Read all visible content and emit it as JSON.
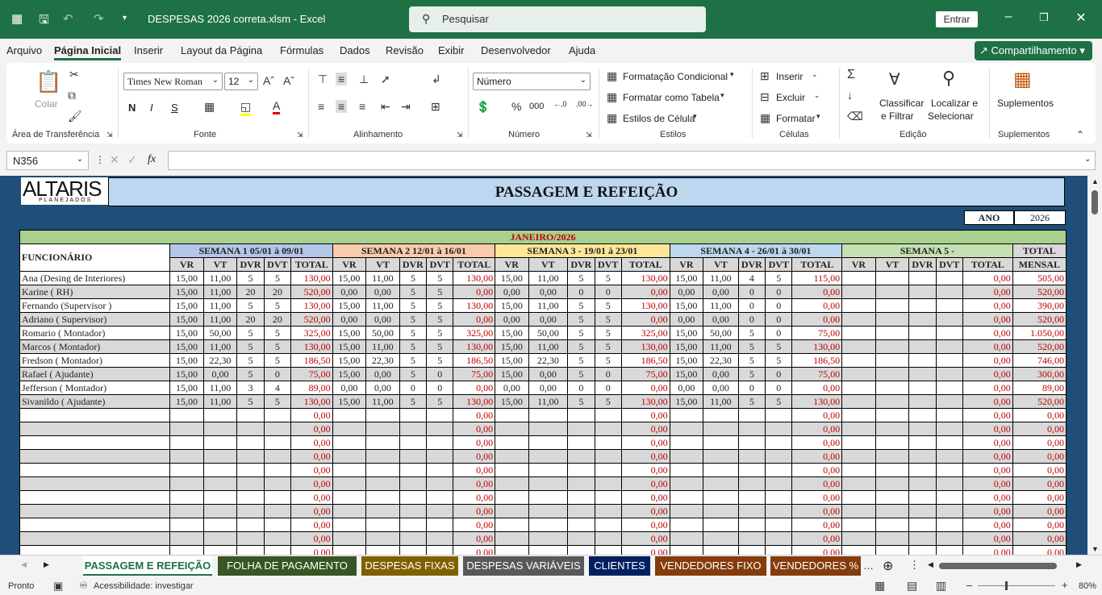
{
  "window": {
    "title": "DESPESAS 2026 correta.xlsm  -  Excel",
    "search_placeholder": "Pesquisar",
    "signin": "Entrar"
  },
  "menu": [
    "Arquivo",
    "Página Inicial",
    "Inserir",
    "Layout da Página",
    "Fórmulas",
    "Dados",
    "Revisão",
    "Exibir",
    "Desenvolvedor",
    "Ajuda"
  ],
  "share_label": "Compartilhamento",
  "ribbon": {
    "paste_label": "Colar",
    "clipboard_group": "Área de Transferência",
    "font_name": "Times New Roman",
    "font_size": "12",
    "bold": "N",
    "italic": "I",
    "underline": "S",
    "font_group": "Fonte",
    "align_group": "Alinhamento",
    "number_format": "Número",
    "number_group": "Número",
    "cond_format": "Formatação Condicional",
    "format_table": "Formatar como Tabela",
    "cell_styles": "Estilos de Célula",
    "styles_group": "Estilos",
    "insert": "Inserir",
    "delete": "Excluir",
    "format": "Formatar",
    "cells_group": "Células",
    "sort_filter_1": "Classificar",
    "sort_filter_2": "e Filtrar",
    "find_select_1": "Localizar e",
    "find_select_2": "Selecionar",
    "editing_group": "Edição",
    "addins": "Suplementos",
    "addins_group": "Suplementos"
  },
  "namebox": "N356",
  "fx": "fx",
  "sheet": {
    "logo_main": "ALTARIS",
    "logo_sub": "PLANEJADOS",
    "title": "PASSAGEM E REFEIÇÃO",
    "ano_label": "ANO",
    "ano_value": "2026",
    "month": "JANEIRO/2026",
    "employee_header": "FUNCIONÁRIO",
    "weeks": [
      "SEMANA 1 05/01 à 09/01",
      "SEMANA 2 12/01 à 16/01",
      "SEMANA 3 - 19/01 à 23/01",
      "SEMANA 4 - 26/01 à 30/01",
      "SEMANA 5 -"
    ],
    "week_colors": [
      "#b4c6e7",
      "#f8cbad",
      "#ffe699",
      "#bdd7ee",
      "#c6e0b4"
    ],
    "subheaders": [
      "VR",
      "VT",
      "DVR",
      "DVT",
      "TOTAL"
    ],
    "total_header_1": "TOTAL",
    "total_header_2": "MENSAL",
    "rows": [
      {
        "name": "Ana (Desing de Interiores)",
        "w": [
          [
            "15,00",
            "11,00",
            "5",
            "5",
            "130,00"
          ],
          [
            "15,00",
            "11,00",
            "5",
            "5",
            "130,00"
          ],
          [
            "15,00",
            "11,00",
            "5",
            "5",
            "130,00"
          ],
          [
            "15,00",
            "11,00",
            "4",
            "5",
            "115,00"
          ],
          [
            "",
            "",
            "",
            "",
            "0,00"
          ]
        ],
        "total": "505,00"
      },
      {
        "name": "Karine ( RH)",
        "w": [
          [
            "15,00",
            "11,00",
            "20",
            "20",
            "520,00"
          ],
          [
            "0,00",
            "0,00",
            "5",
            "5",
            "0,00"
          ],
          [
            "0,00",
            "0,00",
            "0",
            "0",
            "0,00"
          ],
          [
            "0,00",
            "0,00",
            "0",
            "0",
            "0,00"
          ],
          [
            "",
            "",
            "",
            "",
            "0,00"
          ]
        ],
        "total": "520,00"
      },
      {
        "name": "Fernando (Supervisor )",
        "w": [
          [
            "15,00",
            "11,00",
            "5",
            "5",
            "130,00"
          ],
          [
            "15,00",
            "11,00",
            "5",
            "5",
            "130,00"
          ],
          [
            "15,00",
            "11,00",
            "5",
            "5",
            "130,00"
          ],
          [
            "15,00",
            "11,00",
            "0",
            "0",
            "0,00"
          ],
          [
            "",
            "",
            "",
            "",
            "0,00"
          ]
        ],
        "total": "390,00"
      },
      {
        "name": "Adriano ( Supervisor)",
        "w": [
          [
            "15,00",
            "11,00",
            "20",
            "20",
            "520,00"
          ],
          [
            "0,00",
            "0,00",
            "5",
            "5",
            "0,00"
          ],
          [
            "0,00",
            "0,00",
            "5",
            "5",
            "0,00"
          ],
          [
            "0,00",
            "0,00",
            "0",
            "0",
            "0,00"
          ],
          [
            "",
            "",
            "",
            "",
            "0,00"
          ]
        ],
        "total": "520,00"
      },
      {
        "name": "Romario ( Montador)",
        "w": [
          [
            "15,00",
            "50,00",
            "5",
            "5",
            "325,00"
          ],
          [
            "15,00",
            "50,00",
            "5",
            "5",
            "325,00"
          ],
          [
            "15,00",
            "50,00",
            "5",
            "5",
            "325,00"
          ],
          [
            "15,00",
            "50,00",
            "5",
            "0",
            "75,00"
          ],
          [
            "",
            "",
            "",
            "",
            "0,00"
          ]
        ],
        "total": "1.050,00"
      },
      {
        "name": "Marcos ( Montador)",
        "w": [
          [
            "15,00",
            "11,00",
            "5",
            "5",
            "130,00"
          ],
          [
            "15,00",
            "11,00",
            "5",
            "5",
            "130,00"
          ],
          [
            "15,00",
            "11,00",
            "5",
            "5",
            "130,00"
          ],
          [
            "15,00",
            "11,00",
            "5",
            "5",
            "130,00"
          ],
          [
            "",
            "",
            "",
            "",
            "0,00"
          ]
        ],
        "total": "520,00"
      },
      {
        "name": "Fredson ( Montador)",
        "w": [
          [
            "15,00",
            "22,30",
            "5",
            "5",
            "186,50"
          ],
          [
            "15,00",
            "22,30",
            "5",
            "5",
            "186,50"
          ],
          [
            "15,00",
            "22,30",
            "5",
            "5",
            "186,50"
          ],
          [
            "15,00",
            "22,30",
            "5",
            "5",
            "186,50"
          ],
          [
            "",
            "",
            "",
            "",
            "0,00"
          ]
        ],
        "total": "746,00"
      },
      {
        "name": "Rafael ( Ajudante)",
        "w": [
          [
            "15,00",
            "0,00",
            "5",
            "0",
            "75,00"
          ],
          [
            "15,00",
            "0,00",
            "5",
            "0",
            "75,00"
          ],
          [
            "15,00",
            "0,00",
            "5",
            "0",
            "75,00"
          ],
          [
            "15,00",
            "0,00",
            "5",
            "0",
            "75,00"
          ],
          [
            "",
            "",
            "",
            "",
            "0,00"
          ]
        ],
        "total": "300,00"
      },
      {
        "name": "Jefferson ( Montador)",
        "w": [
          [
            "15,00",
            "11,00",
            "3",
            "4",
            "89,00"
          ],
          [
            "0,00",
            "0,00",
            "0",
            "0",
            "0,00"
          ],
          [
            "0,00",
            "0,00",
            "0",
            "0",
            "0,00"
          ],
          [
            "0,00",
            "0,00",
            "0",
            "0",
            "0,00"
          ],
          [
            "",
            "",
            "",
            "",
            "0,00"
          ]
        ],
        "total": "89,00"
      },
      {
        "name": "Sivanildo ( Ajudante)",
        "w": [
          [
            "15,00",
            "11,00",
            "5",
            "5",
            "130,00"
          ],
          [
            "15,00",
            "11,00",
            "5",
            "5",
            "130,00"
          ],
          [
            "15,00",
            "11,00",
            "5",
            "5",
            "130,00"
          ],
          [
            "15,00",
            "11,00",
            "5",
            "5",
            "130,00"
          ],
          [
            "",
            "",
            "",
            "",
            "0,00"
          ]
        ],
        "total": "520,00"
      }
    ],
    "empty_total": "0,00",
    "empty_rows": 11
  },
  "tabs": [
    {
      "label": "PASSAGEM E REFEIÇÃO",
      "color": "#ffffff",
      "active": true
    },
    {
      "label": "FOLHA DE PAGAMENTO",
      "color": "#375623"
    },
    {
      "label": "DESPESAS FIXAS",
      "color": "#7f6000"
    },
    {
      "label": "DESPESAS VARIÁVEIS",
      "color": "#595959"
    },
    {
      "label": "CLIENTES",
      "color": "#002060"
    },
    {
      "label": "VENDEDORES FIXO",
      "color": "#843c0c"
    },
    {
      "label": "VENDEDORES %",
      "color": "#843c0c"
    }
  ],
  "status": {
    "ready": "Pronto",
    "accessibility": "Acessibilidade: investigar",
    "zoom": "80%"
  }
}
